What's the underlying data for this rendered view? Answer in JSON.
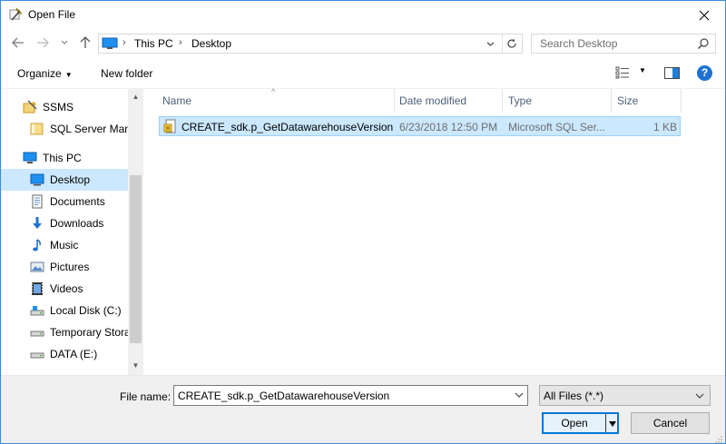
{
  "window": {
    "title": "Open File"
  },
  "address": {
    "crumbs": [
      "This PC",
      "Desktop"
    ]
  },
  "search": {
    "placeholder": "Search Desktop"
  },
  "toolbar": {
    "organize": "Organize",
    "new_folder": "New folder"
  },
  "nav": {
    "items": [
      {
        "label": "SSMS",
        "icon": "ssms-folder-icon"
      },
      {
        "label": "SQL Server Mana",
        "icon": "folder-icon"
      },
      {
        "label": "This PC",
        "icon": "pc-icon"
      },
      {
        "label": "Desktop",
        "icon": "desktop-icon",
        "selected": true
      },
      {
        "label": "Documents",
        "icon": "documents-icon"
      },
      {
        "label": "Downloads",
        "icon": "downloads-icon"
      },
      {
        "label": "Music",
        "icon": "music-icon"
      },
      {
        "label": "Pictures",
        "icon": "pictures-icon"
      },
      {
        "label": "Videos",
        "icon": "videos-icon"
      },
      {
        "label": "Local Disk (C:)",
        "icon": "drive-c-icon"
      },
      {
        "label": "Temporary Stora",
        "icon": "drive-icon"
      },
      {
        "label": "DATA (E:)",
        "icon": "drive-icon"
      }
    ]
  },
  "columns": {
    "name": "Name",
    "date": "Date modified",
    "type": "Type",
    "size": "Size"
  },
  "files": [
    {
      "name": "CREATE_sdk.p_GetDatawarehouseVersion",
      "date": "6/23/2018 12:50 PM",
      "type": "Microsoft SQL Ser...",
      "size": "1 KB"
    }
  ],
  "bottom": {
    "file_name_label": "File name:",
    "file_name_value": "CREATE_sdk.p_GetDatawarehouseVersion",
    "file_type": "All Files (*.*)",
    "open": "Open",
    "cancel": "Cancel"
  },
  "colors": {
    "accent": "#0078d7",
    "selection": "#cce8ff",
    "header_text": "#4c607a"
  }
}
